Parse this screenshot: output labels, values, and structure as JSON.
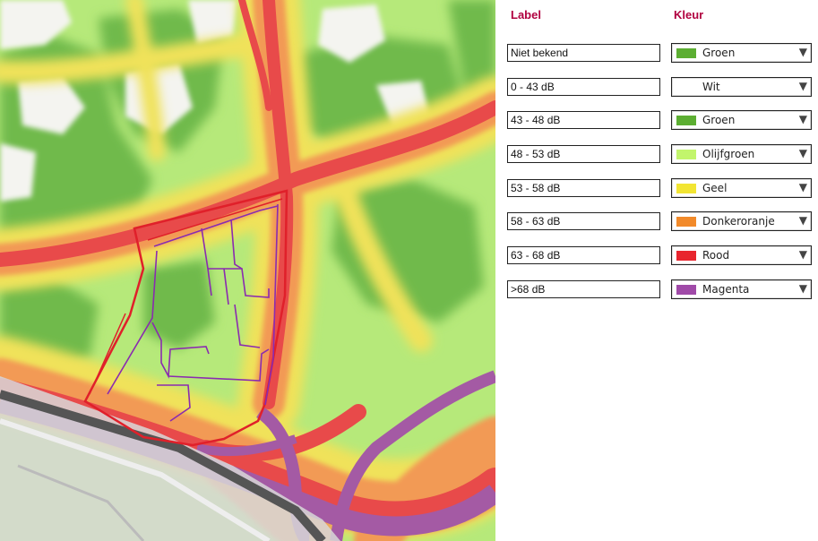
{
  "legend": {
    "label_header": "Label",
    "color_header": "Kleur",
    "header_color": "#b0003f",
    "rows": [
      {
        "label": "Niet bekend",
        "color_name": "Groen",
        "swatch": "#5cae32"
      },
      {
        "label": "0 - 43 dB",
        "color_name": "Wit",
        "swatch": "#ffffff"
      },
      {
        "label": "43 - 48 dB",
        "color_name": "Groen",
        "swatch": "#5cae32"
      },
      {
        "label": "48 - 53 dB",
        "color_name": "Olijfgroen",
        "swatch": "#c2f56c"
      },
      {
        "label": "53 - 58 dB",
        "color_name": "Geel",
        "swatch": "#f2e533"
      },
      {
        "label": "58 - 63 dB",
        "color_name": "Donkeroranje",
        "swatch": "#f28a2a"
      },
      {
        "label": "63 - 68 dB",
        "color_name": "Rood",
        "swatch": "#e8252e"
      },
      {
        "label": ">68 dB",
        "color_name": "Magenta",
        "swatch": "#a04aa8"
      }
    ],
    "dropdown_icon": "triangle-down-icon"
  },
  "map": {
    "colors": {
      "dark_green": "#6fba4c",
      "olive_green": "#b6e97a",
      "yellow": "#f0e25a",
      "orange": "#f29a55",
      "red": "#e84a4a",
      "magenta": "#a45aa4",
      "plan_outline": "#e0202a",
      "plot_lines": "#8a2bb0"
    }
  }
}
